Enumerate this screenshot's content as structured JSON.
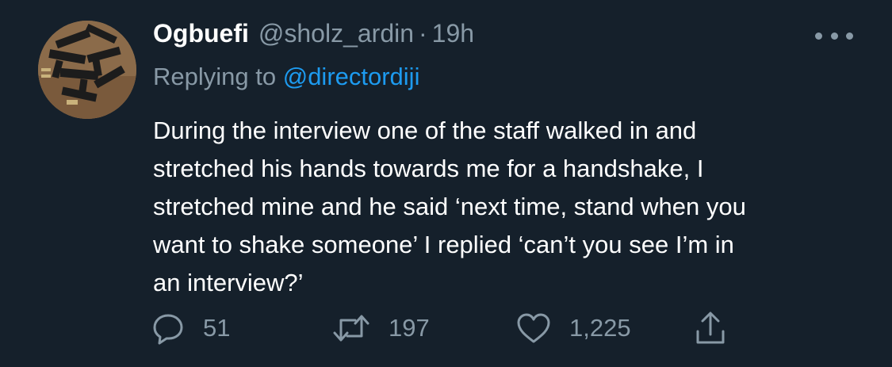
{
  "tweet": {
    "author_name": "Ogbuefi",
    "handle": "@sholz_ardin",
    "separator": "·",
    "time": "19h",
    "replying_prefix": "Replying to",
    "replying_to": "@directordiji",
    "text_lines": [
      "During the interview one of the staff walked in and",
      "stretched his hands towards me for a handshake, I",
      "stretched mine and he said ‘next time, stand when you",
      "want to shake someone’ I replied ‘can’t you see I’m in",
      "an interview?’"
    ]
  },
  "actions": {
    "reply_count": "51",
    "retweet_count": "197",
    "like_count": "1,225"
  },
  "icons": {
    "more": "more-horizontal-icon",
    "reply": "reply-icon",
    "retweet": "retweet-icon",
    "like": "heart-icon",
    "share": "share-icon"
  },
  "colors": {
    "background": "#15202b",
    "primary_text": "#ffffff",
    "secondary_text": "#8899a6",
    "link": "#1d9bf0"
  }
}
